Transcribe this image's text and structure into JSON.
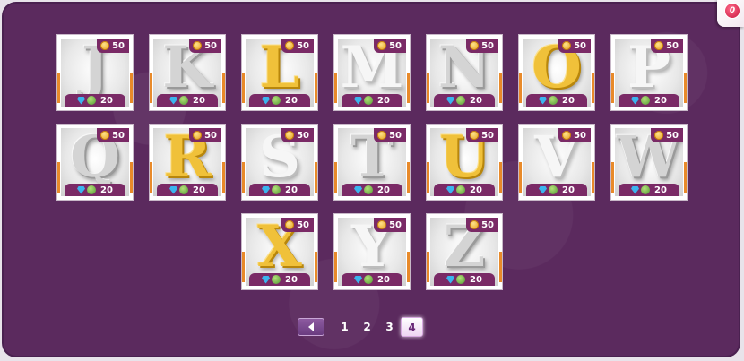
{
  "notifications": {
    "count": "0"
  },
  "tiles": [
    {
      "letter": "J",
      "style": "silver",
      "coins": "50",
      "gems": "20"
    },
    {
      "letter": "K",
      "style": "silver",
      "coins": "50",
      "gems": "20"
    },
    {
      "letter": "L",
      "style": "gold",
      "coins": "50",
      "gems": "20"
    },
    {
      "letter": "M",
      "style": "white",
      "coins": "50",
      "gems": "20"
    },
    {
      "letter": "N",
      "style": "silver",
      "coins": "50",
      "gems": "20"
    },
    {
      "letter": "O",
      "style": "gold",
      "coins": "50",
      "gems": "20"
    },
    {
      "letter": "P",
      "style": "white",
      "coins": "50",
      "gems": "20"
    },
    {
      "letter": "Q",
      "style": "silver",
      "coins": "50",
      "gems": "20"
    },
    {
      "letter": "R",
      "style": "gold",
      "coins": "50",
      "gems": "20"
    },
    {
      "letter": "S",
      "style": "white",
      "coins": "50",
      "gems": "20"
    },
    {
      "letter": "T",
      "style": "silver",
      "coins": "50",
      "gems": "20"
    },
    {
      "letter": "U",
      "style": "gold",
      "coins": "50",
      "gems": "20"
    },
    {
      "letter": "V",
      "style": "white",
      "coins": "50",
      "gems": "20"
    },
    {
      "letter": "W",
      "style": "silver",
      "coins": "50",
      "gems": "20"
    },
    {
      "letter": "X",
      "style": "gold",
      "coins": "50",
      "gems": "20"
    },
    {
      "letter": "Y",
      "style": "white",
      "coins": "50",
      "gems": "20"
    },
    {
      "letter": "Z",
      "style": "silver",
      "coins": "50",
      "gems": "20"
    }
  ],
  "pagination": {
    "prev_icon": "chevron-left-icon",
    "pages": [
      "1",
      "2",
      "3",
      "4"
    ],
    "current": "4"
  },
  "colors": {
    "panel": "#5b2a5e",
    "price_bar": "#7a2a66",
    "gold": "#f0c13a",
    "silver": "#d4d4d4"
  }
}
